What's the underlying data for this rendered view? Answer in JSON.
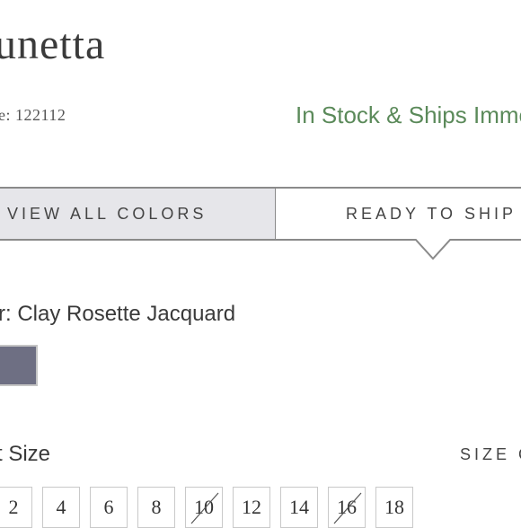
{
  "product": {
    "title": "unetta",
    "style_number": "e: 122112",
    "availability": "In Stock & Ships Imme"
  },
  "tabs": [
    {
      "label": "VIEW ALL COLORS",
      "selected": false
    },
    {
      "label": "READY TO SHIP",
      "selected": true
    }
  ],
  "color": {
    "label": "r: Clay Rosette Jacquard",
    "swatch_color": "#6e6f83"
  },
  "size": {
    "label": "t Size",
    "guide_label": "SIZE G",
    "options": [
      {
        "label": "2",
        "available": true
      },
      {
        "label": "4",
        "available": true
      },
      {
        "label": "6",
        "available": true
      },
      {
        "label": "8",
        "available": true
      },
      {
        "label": "10",
        "available": false
      },
      {
        "label": "12",
        "available": true
      },
      {
        "label": "14",
        "available": true
      },
      {
        "label": "16",
        "available": false
      },
      {
        "label": "18",
        "available": true
      }
    ]
  },
  "colors": {
    "in_stock": "#5b8a5a",
    "tab_selected_bg": "#ffffff",
    "tab_unselected_bg": "#e6e6ea",
    "border": "#8a8a8a"
  }
}
